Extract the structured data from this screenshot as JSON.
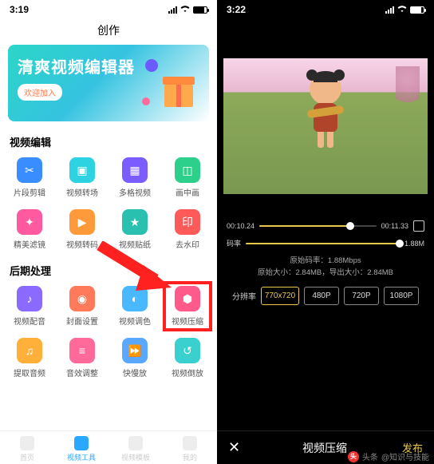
{
  "left": {
    "status": {
      "time": "3:19"
    },
    "title": "创作",
    "banner": {
      "title": "清爽视频编辑器",
      "cta": "欢迎加入"
    },
    "section1": "视频编辑",
    "edit_tools": [
      {
        "label": "片段剪辑"
      },
      {
        "label": "视频转场"
      },
      {
        "label": "多格视频"
      },
      {
        "label": "画中画"
      },
      {
        "label": "精美滤镜"
      },
      {
        "label": "视频转码"
      },
      {
        "label": "视频贴纸"
      },
      {
        "label": "去水印"
      }
    ],
    "section2": "后期处理",
    "post_tools": [
      {
        "label": "视频配音"
      },
      {
        "label": "封面设置"
      },
      {
        "label": "视频调色"
      },
      {
        "label": "视频压缩"
      },
      {
        "label": "提取音频"
      },
      {
        "label": "音效调整"
      },
      {
        "label": "快慢放"
      },
      {
        "label": "视频倒放"
      }
    ],
    "tabs": [
      {
        "label": "首页"
      },
      {
        "label": "视频工具"
      },
      {
        "label": "视频模板"
      },
      {
        "label": "我的"
      }
    ]
  },
  "right": {
    "status": {
      "time": "3:22"
    },
    "timeline": {
      "start": "00:10.24",
      "end": "00:11.33"
    },
    "bitrate": {
      "label": "码率",
      "value": "1.88M"
    },
    "info": {
      "orig_rate_label": "原始码率：",
      "orig_rate": "1.88Mbps",
      "orig_size_label": "原始大小：",
      "orig_size": "2.84MB",
      "out_size_label": "导出大小：",
      "out_size": "2.84MB"
    },
    "res": {
      "label": "分辨率",
      "options": [
        "770x720",
        "480P",
        "720P",
        "1080P"
      ]
    },
    "bottom": {
      "title": "视频压缩",
      "publish": "发布"
    }
  },
  "credit": {
    "site": "头条",
    "author": "@知识与技能"
  }
}
